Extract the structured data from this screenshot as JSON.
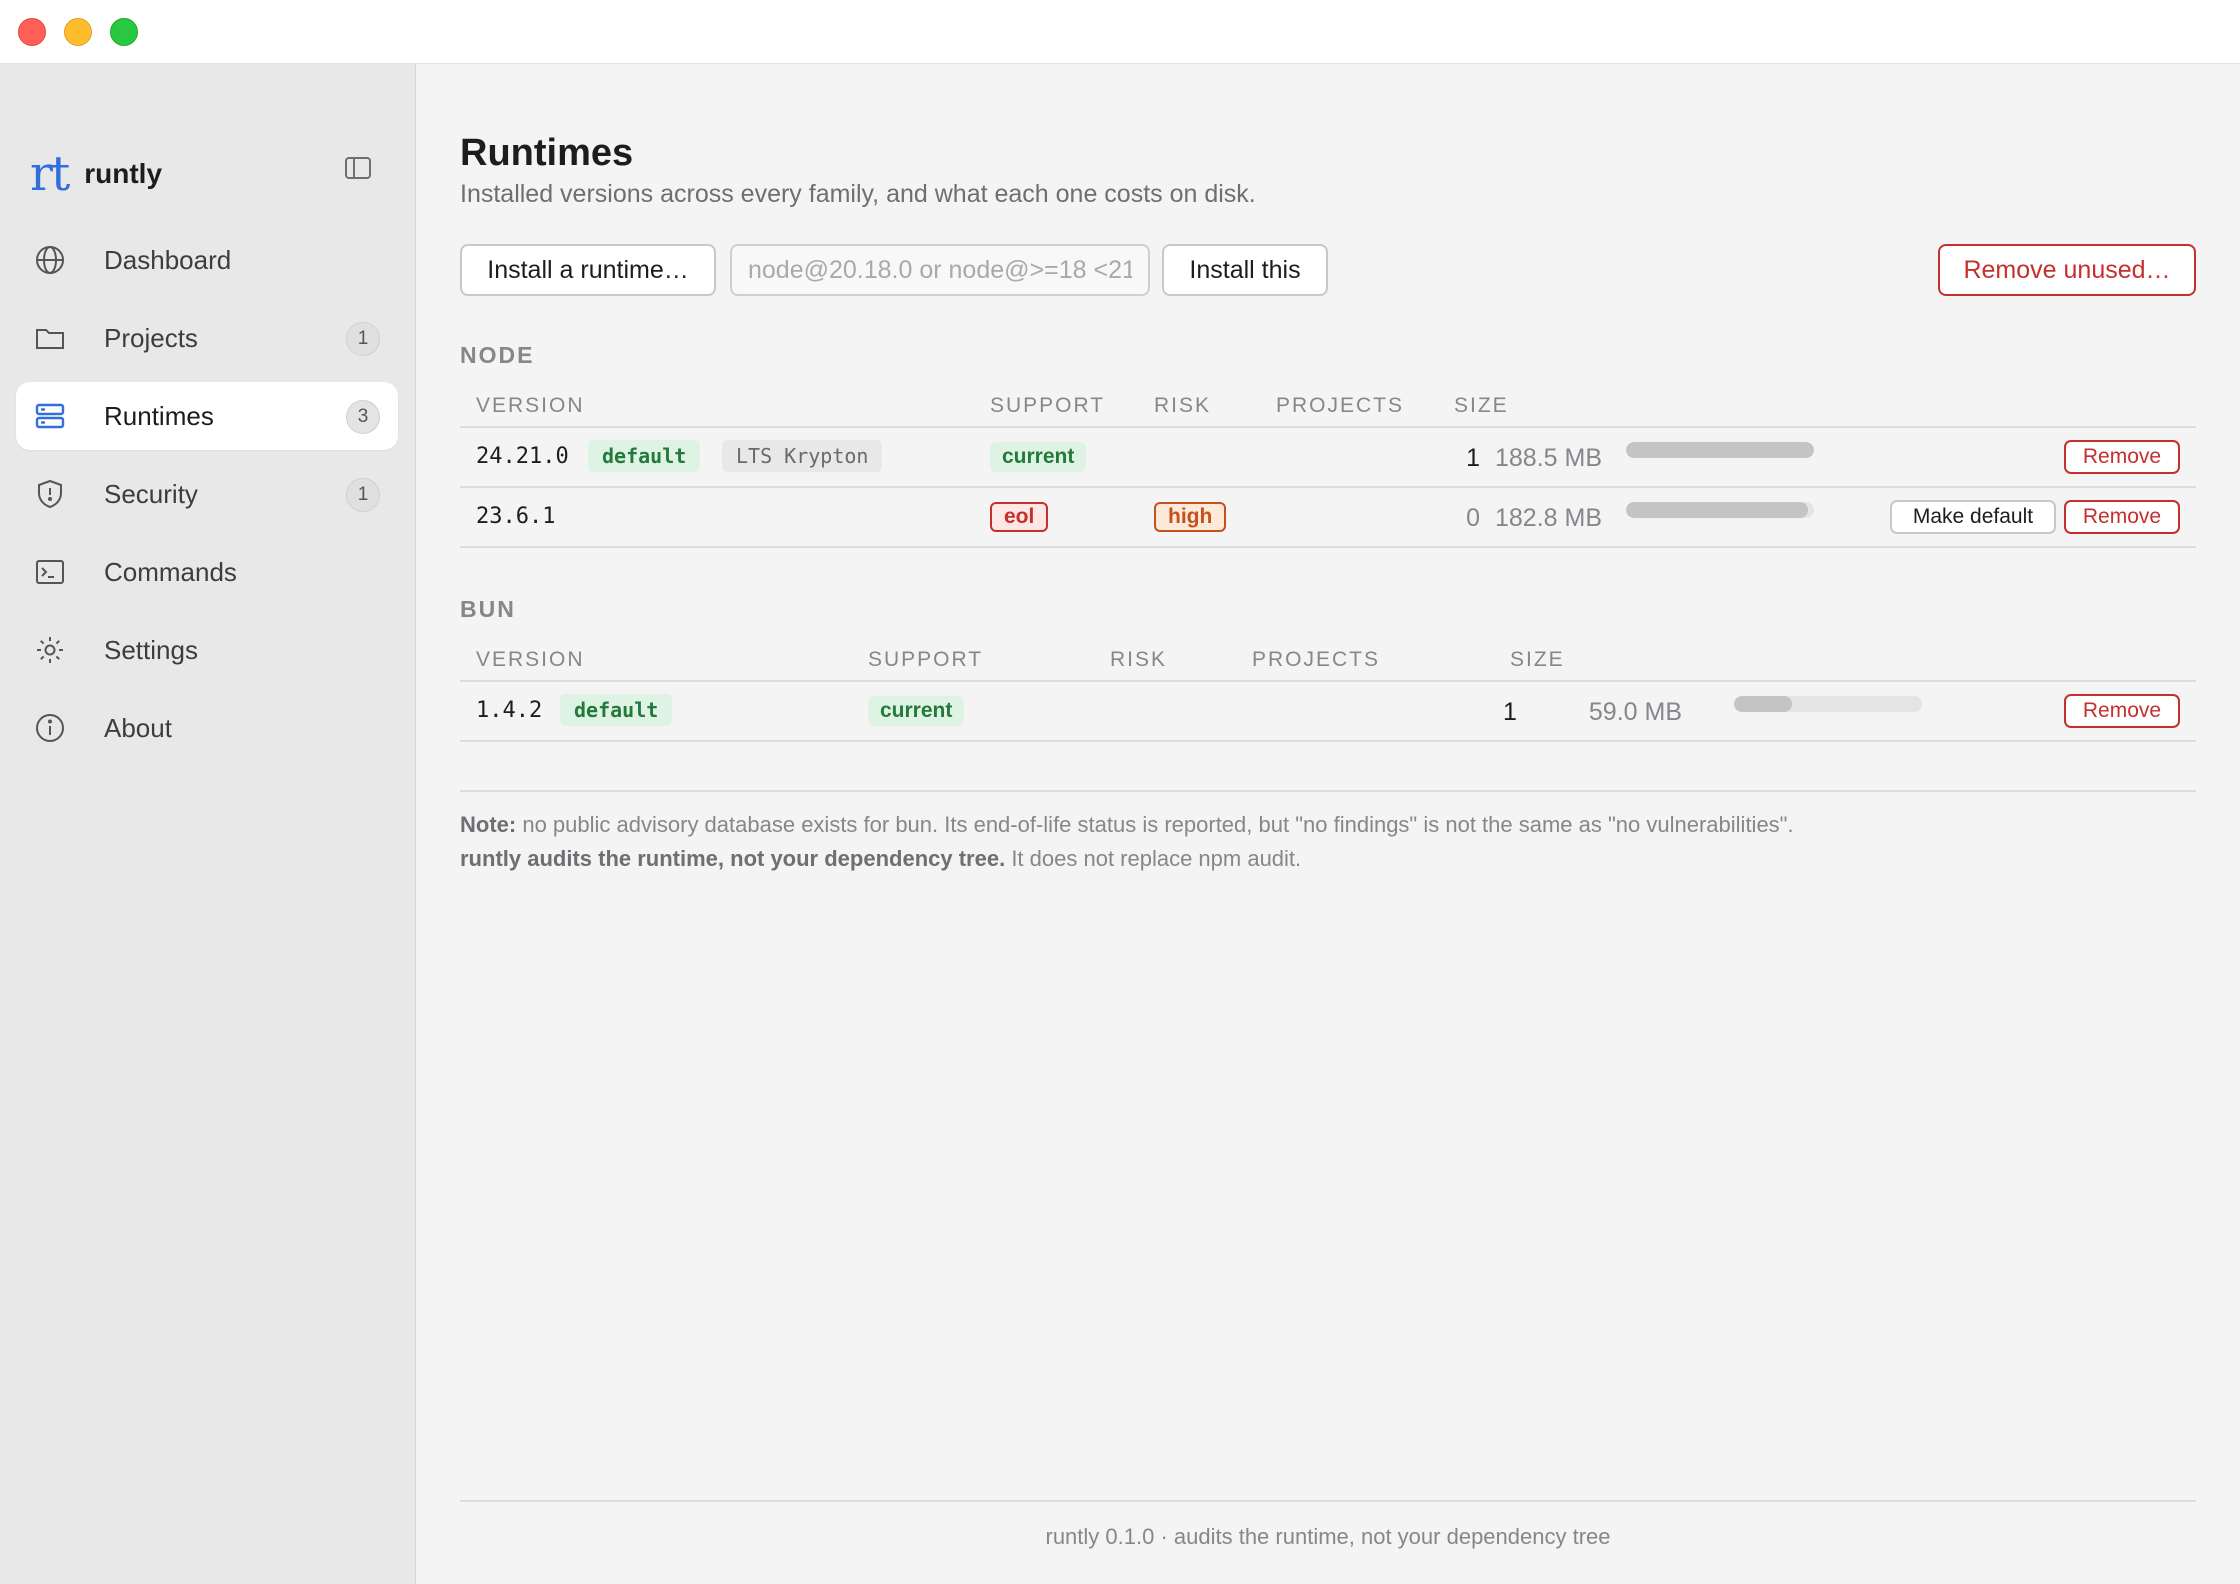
{
  "sidebar": {
    "brand_logo": "rt",
    "brand_name": "runtly",
    "items": [
      {
        "label": "Dashboard",
        "icon": "globe-icon",
        "badge": null
      },
      {
        "label": "Projects",
        "icon": "folder-icon",
        "badge": "1"
      },
      {
        "label": "Runtimes",
        "icon": "server-icon",
        "badge": "3",
        "active": true
      },
      {
        "label": "Security",
        "icon": "shield-icon",
        "badge": "1"
      },
      {
        "label": "Commands",
        "icon": "terminal-icon",
        "badge": null
      },
      {
        "label": "Settings",
        "icon": "gear-icon",
        "badge": null
      },
      {
        "label": "About",
        "icon": "info-icon",
        "badge": null
      }
    ]
  },
  "page": {
    "title": "Runtimes",
    "subtitle": "Installed versions across every family, and what each one costs on disk."
  },
  "toolbar": {
    "install_label": "Install a runtime…",
    "search_placeholder": "node@20.18.0 or node@>=18 <21",
    "install_this_label": "Install this",
    "remove_unused_label": "Remove unused…"
  },
  "node": {
    "label": "NODE",
    "columns": [
      "VERSION",
      "SUPPORT",
      "RISK",
      "PROJECTS",
      "SIZE"
    ],
    "rows": [
      {
        "version": "24.21.0",
        "tags": [
          "default",
          "LTS Krypton"
        ],
        "support": "current",
        "risk": "",
        "projects": "1",
        "size": "188.5 MB",
        "size_fraction": 1.0,
        "actions": [
          "Remove"
        ]
      },
      {
        "version": "23.6.1",
        "tags": [],
        "support": "eol",
        "risk": "high",
        "projects": "0",
        "size": "182.8 MB",
        "size_fraction": 0.97,
        "actions": [
          "Make default",
          "Remove"
        ]
      }
    ]
  },
  "bun": {
    "label": "BUN",
    "columns": [
      "VERSION",
      "SUPPORT",
      "RISK",
      "PROJECTS",
      "SIZE"
    ],
    "rows": [
      {
        "version": "1.4.2",
        "tags": [
          "default"
        ],
        "support": "current",
        "risk": "",
        "projects": "1",
        "size": "59.0 MB",
        "size_fraction": 0.31,
        "actions": [
          "Remove"
        ]
      }
    ]
  },
  "note": {
    "label": "Note:",
    "text1": "no public advisory database exists for bun. Its end-of-life status is reported, but \"no findings\" is not the same as \"no vulnerabilities\".",
    "bold2": "runtly audits the runtime, not your dependency tree.",
    "text2": "It does not replace npm audit."
  },
  "footer": "runtly 0.1.0 · audits the runtime, not your dependency tree",
  "colors": {
    "accent": "#2f6fde",
    "danger": "#c5302e",
    "success": "#237a3b",
    "warning": "#c4511f"
  }
}
